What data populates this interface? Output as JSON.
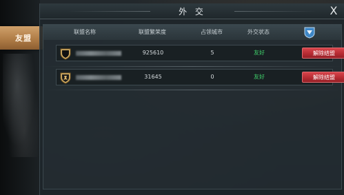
{
  "window": {
    "title": "外 交",
    "close_label": "X"
  },
  "side_tab": {
    "label": "友盟"
  },
  "table": {
    "headers": [
      "联盟名称",
      "联盟繁荣度",
      "占领城市",
      "外交状态"
    ],
    "header_badge_icon": "alliance-emblem-icon",
    "rows": [
      {
        "name": "",
        "prosperity": "925610",
        "cities": "5",
        "status": "友好",
        "action": "解除结盟",
        "emblem": "black-shield-icon"
      },
      {
        "name": "",
        "prosperity": "31645",
        "cities": "0",
        "status": "友好",
        "action": "解除结盟",
        "emblem": "gold-lion-shield-icon"
      }
    ]
  },
  "colors": {
    "status_friendly": "#3fcf6a",
    "action_button": "#c2323a",
    "side_tab": "#b07d47"
  }
}
